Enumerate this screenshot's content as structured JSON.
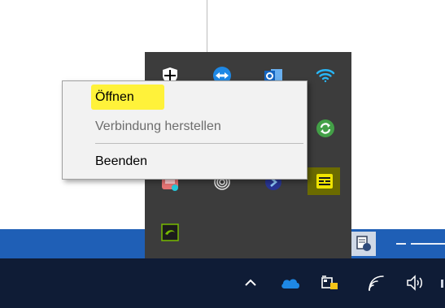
{
  "context_menu": {
    "items": [
      {
        "label": "Öffnen",
        "enabled": true,
        "highlighted": true
      },
      {
        "label": "Verbindung herstellen",
        "enabled": false
      },
      {
        "label": "Beenden",
        "enabled": true
      }
    ]
  },
  "tray_overflow": {
    "icons": [
      "security-shield-icon",
      "teamviewer-icon",
      "outlook-icon",
      "wifi-icon",
      "sync-icon",
      "app-red-icon",
      "fingerprint-icon",
      "blue-arrow-icon",
      "yellow-app-icon",
      "nvidia-icon"
    ]
  },
  "taskbar": {
    "icons": [
      "chevron-up-icon",
      "onedrive-cloud-icon",
      "network-power-icon",
      "wifi-signal-icon",
      "speaker-icon"
    ]
  },
  "colors": {
    "taskbar": "#0f1c36",
    "flyout": "#3c3c3c",
    "window_strip": "#1f5fb6",
    "highlight": "#fff23a"
  }
}
